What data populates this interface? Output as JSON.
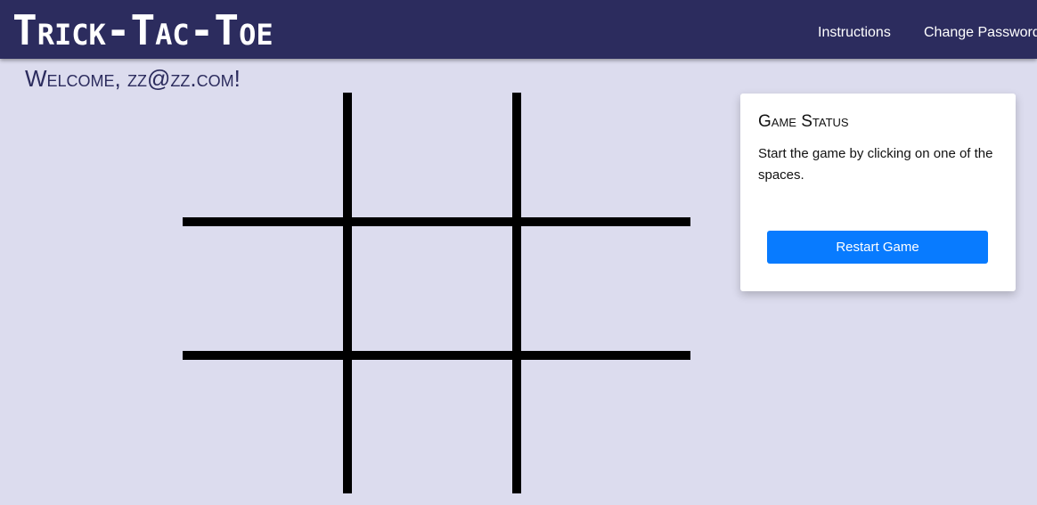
{
  "navbar": {
    "brand": "Trick-Tac-Toe",
    "links": [
      {
        "label": "Instructions"
      },
      {
        "label": "Change Password"
      }
    ]
  },
  "welcome": {
    "text": "Welcome, zz@zz.com!"
  },
  "board": {
    "cells": [
      "",
      "",
      "",
      "",
      "",
      "",
      "",
      "",
      ""
    ]
  },
  "status": {
    "title": "Game Status",
    "message": "Start the game by clicking on one of the spaces.",
    "restart_label": "Restart Game"
  },
  "colors": {
    "navbar_bg": "#2c2c5e",
    "page_bg": "#dcdcee",
    "button_bg": "#087bff",
    "board_lines": "#000000"
  }
}
